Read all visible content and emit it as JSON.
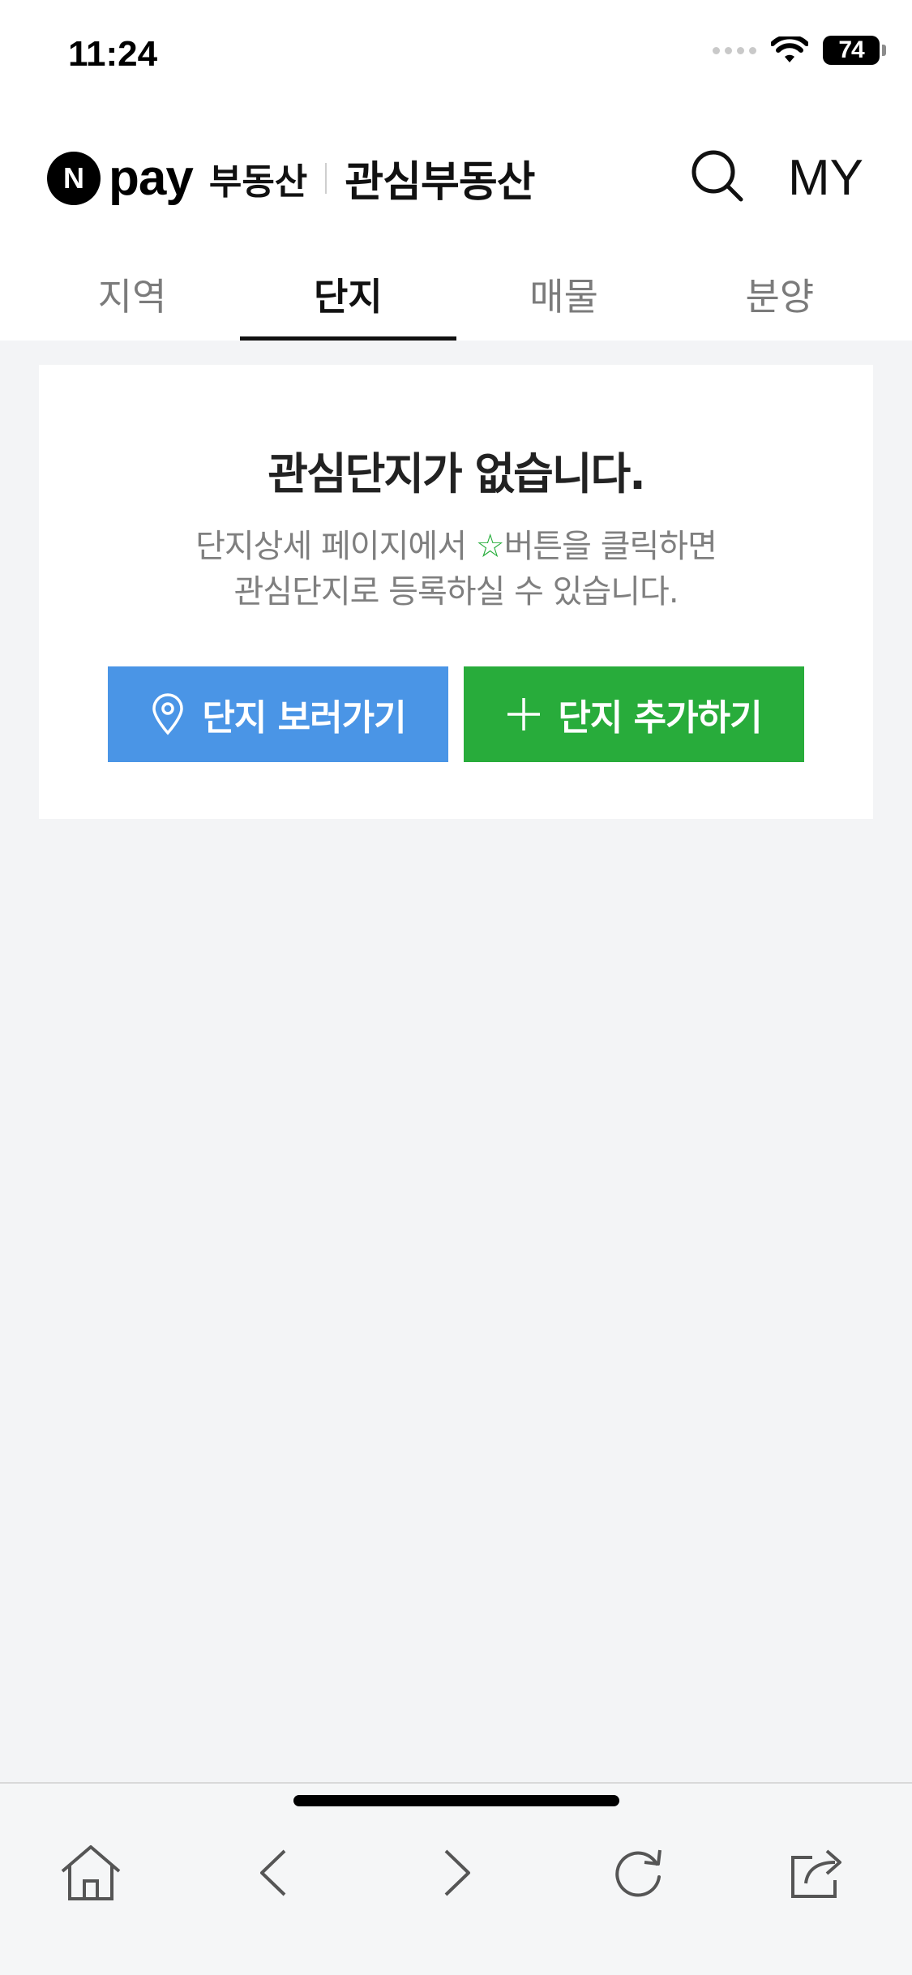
{
  "status_bar": {
    "time": "11:24",
    "battery": "74"
  },
  "header": {
    "logo_letter": "N",
    "logo_text": "pay",
    "service": "부동산",
    "title": "관심부동산",
    "my_label": "MY"
  },
  "tabs": [
    {
      "label": "지역",
      "active": false
    },
    {
      "label": "단지",
      "active": true
    },
    {
      "label": "매물",
      "active": false
    },
    {
      "label": "분양",
      "active": false
    }
  ],
  "empty_state": {
    "title": "관심단지가 없습니다.",
    "desc_line1_before": "단지상세 페이지에서 ",
    "star": "☆",
    "desc_line1_after": "버튼을 클릭하면",
    "desc_line2": "관심단지로 등록하실 수 있습니다.",
    "view_button": "단지 보러가기",
    "add_button": "단지 추가하기"
  },
  "colors": {
    "view_button": "#4a95e6",
    "add_button": "#28ac3b",
    "star": "#27ae3c"
  },
  "toolbar": {
    "icons": [
      "home-icon",
      "back-icon",
      "forward-icon",
      "reload-icon",
      "share-icon"
    ]
  }
}
